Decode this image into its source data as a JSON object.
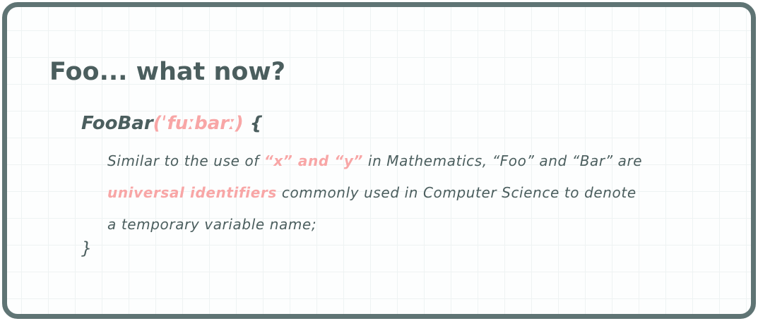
{
  "title": "Foo... what now?",
  "definition": {
    "term": "FooBar",
    "pronunciation": "(ˈfuːbarː)",
    "open_brace": "{",
    "close_brace": "}",
    "line1": {
      "a": "Similar to the use of ",
      "b": "“x” and “y”",
      "c": " in Mathematics, “Foo” and “Bar” are"
    },
    "line2": {
      "a": "universal identifiers",
      "b": " commonly used in Computer Science to denote"
    },
    "line3": "a temporary variable name;"
  },
  "colors": {
    "border": "#5f7474",
    "text": "#4b5e5e",
    "accent": "#f8a6a6"
  }
}
